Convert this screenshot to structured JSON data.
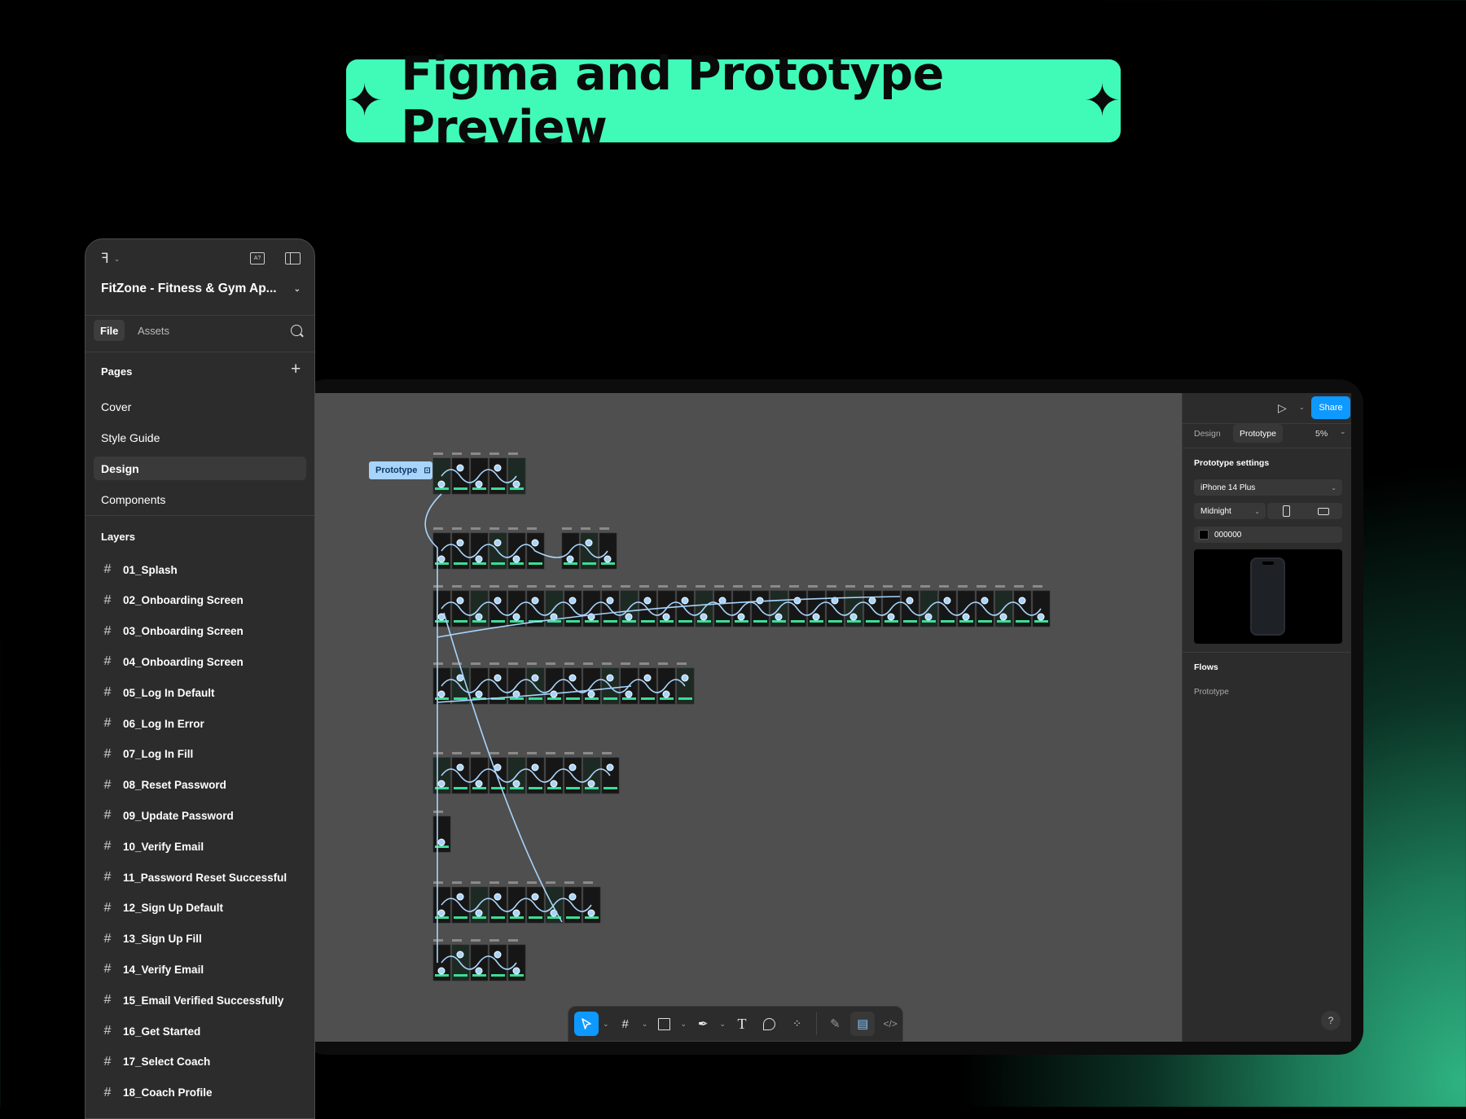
{
  "banner": {
    "title": "Figma and Prototype Preview",
    "left_icon": "sparkle-icon",
    "right_icon": "sparkle-icon"
  },
  "left_panel": {
    "project_name": "FitZone - Fitness & Gym Ap...",
    "tabs": [
      "File",
      "Assets"
    ],
    "active_tab": "File",
    "pages_label": "Pages",
    "pages": [
      "Cover",
      "Style Guide",
      "Design",
      "Components"
    ],
    "selected_page": "Design",
    "layers_label": "Layers",
    "layers": [
      "01_Splash",
      "02_Onboarding Screen",
      "03_Onboarding Screen",
      "04_Onboarding Screen",
      "05_Log In Default",
      "06_Log In Error",
      "07_Log In Fill",
      "08_Reset Password",
      "09_Update Password",
      "10_Verify Email",
      "11_Password Reset Successful",
      "12_Sign Up Default",
      "13_Sign Up Fill",
      "14_Verify Email",
      "15_Email Verified Successfully",
      "16_Get Started",
      "17_Select Coach",
      "18_Coach Profile"
    ]
  },
  "right_panel": {
    "share_label": "Share",
    "tabs": [
      "Design",
      "Prototype"
    ],
    "active_tab": "Prototype",
    "zoom": "5%",
    "settings_title": "Prototype settings",
    "device": "iPhone 14 Plus",
    "model": "Midnight",
    "bg_color": "000000",
    "flows_title": "Flows",
    "flow_item": "Prototype",
    "help": "?"
  },
  "canvas": {
    "prototype_tag": "Prototype"
  },
  "colors": {
    "accent": "#40fbb8",
    "blue": "#0d99ff",
    "panel": "#2c2c2c",
    "canvas": "#4f4f4f",
    "link": "#a8d4fb"
  }
}
